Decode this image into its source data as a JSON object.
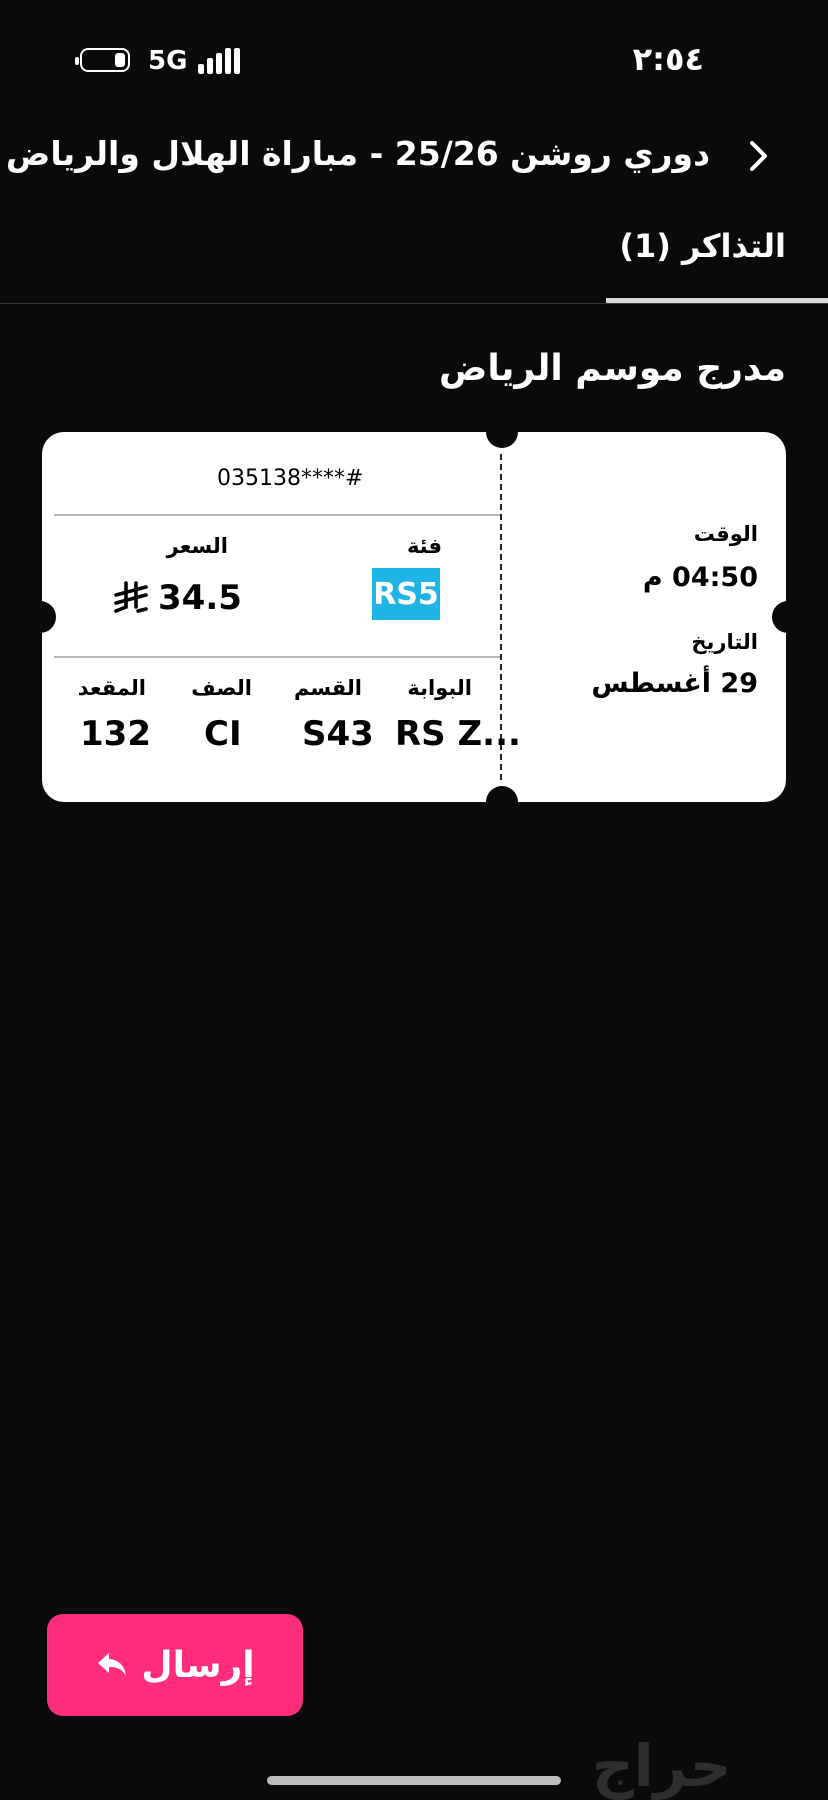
{
  "status_bar": {
    "time": "٢:٥٤",
    "network": "5G",
    "battery_icon": "battery-icon",
    "signal_icon": "signal-icon"
  },
  "header": {
    "title": "دوري روشن 25/26 -  مباراة الهلال والرياض",
    "back_icon": "chevron-right-icon"
  },
  "tabs": [
    {
      "label": "التذاكر (1)",
      "active": true
    }
  ],
  "venue": {
    "name": "مدرج موسم الرياض"
  },
  "ticket": {
    "number": "035138****#",
    "category_label": "فئة",
    "category_value": "RS5",
    "category_color": "#1fb4e6",
    "price_label": "السعر",
    "price_value": "34.5",
    "currency_icon": "saudi-riyal-icon",
    "gate_label": "البوابة",
    "gate_value": "RS Z...",
    "section_label": "القسم",
    "section_value": "S43",
    "row_label": "الصف",
    "row_value": "CI",
    "seat_label": "المقعد",
    "seat_value": "132",
    "time_label": "الوقت",
    "time_value": "04:50 م",
    "date_label": "التاريخ",
    "date_value": "29 أغسطس"
  },
  "actions": {
    "send_label": "إرسال",
    "send_icon": "reply-arrow-icon",
    "send_color": "#ff2d7c"
  },
  "watermark": "حراج"
}
